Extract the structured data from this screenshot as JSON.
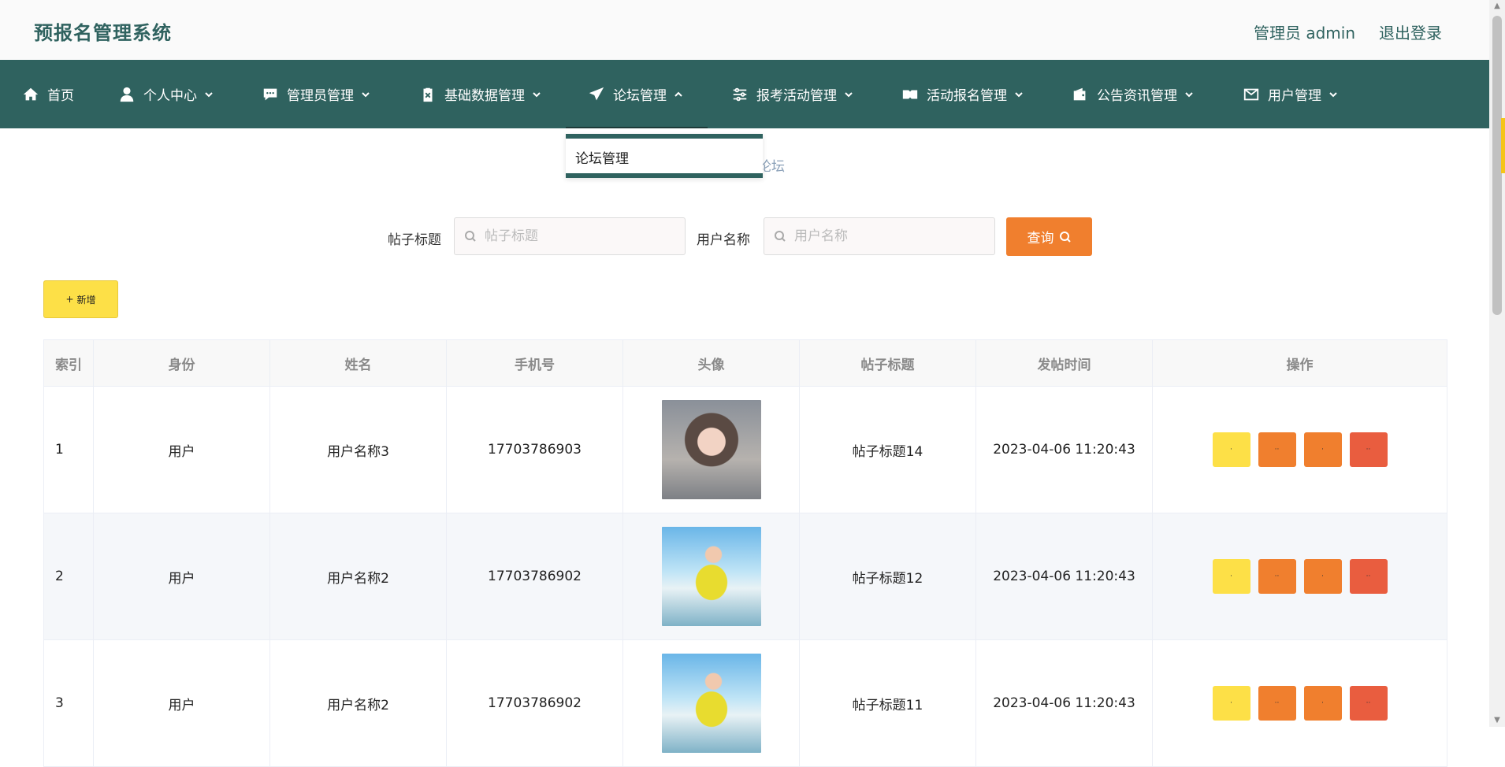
{
  "header": {
    "app_title": "预报名管理系统",
    "user_label": "管理员 admin",
    "logout_label": "退出登录"
  },
  "nav": {
    "items": [
      {
        "label": "首页",
        "icon": "home-icon"
      },
      {
        "label": "个人中心",
        "icon": "user-icon"
      },
      {
        "label": "管理员管理",
        "icon": "chat-icon"
      },
      {
        "label": "基础数据管理",
        "icon": "clipboard-icon"
      },
      {
        "label": "论坛管理",
        "icon": "send-icon",
        "expanded": true
      },
      {
        "label": "报考活动管理",
        "icon": "sliders-icon"
      },
      {
        "label": "活动报名管理",
        "icon": "ticket-icon"
      },
      {
        "label": "公告资讯管理",
        "icon": "wallet-icon"
      },
      {
        "label": "用户管理",
        "icon": "mail-icon"
      }
    ],
    "dropdown": {
      "items": [
        "论坛管理"
      ]
    }
  },
  "breadcrumb_fragment": "论坛",
  "search": {
    "title_label": "帖子标题",
    "title_placeholder": "帖子标题",
    "user_label": "用户名称",
    "user_placeholder": "用户名称",
    "query_label": "查询"
  },
  "toolbar": {
    "add_label": "新增"
  },
  "table": {
    "headers": [
      "索引",
      "身份",
      "姓名",
      "手机号",
      "头像",
      "帖子标题",
      "发帖时间",
      "操作"
    ],
    "rows": [
      {
        "index": "1",
        "role": "用户",
        "name": "用户名称3",
        "phone": "17703786903",
        "avatar": "portrait-photo",
        "title": "帖子标题14",
        "time": "2023-04-06 11:20:43"
      },
      {
        "index": "2",
        "role": "用户",
        "name": "用户名称2",
        "phone": "17703786902",
        "avatar": "beach-photo",
        "title": "帖子标题12",
        "time": "2023-04-06 11:20:43"
      },
      {
        "index": "3",
        "role": "用户",
        "name": "用户名称2",
        "phone": "17703786902",
        "avatar": "beach-photo",
        "title": "帖子标题11",
        "time": "2023-04-06 11:20:43"
      }
    ]
  },
  "colors": {
    "primary": "#2f625f",
    "accent_orange": "#f07f2e",
    "accent_yellow": "#fde047",
    "accent_red": "#e95d3f"
  }
}
